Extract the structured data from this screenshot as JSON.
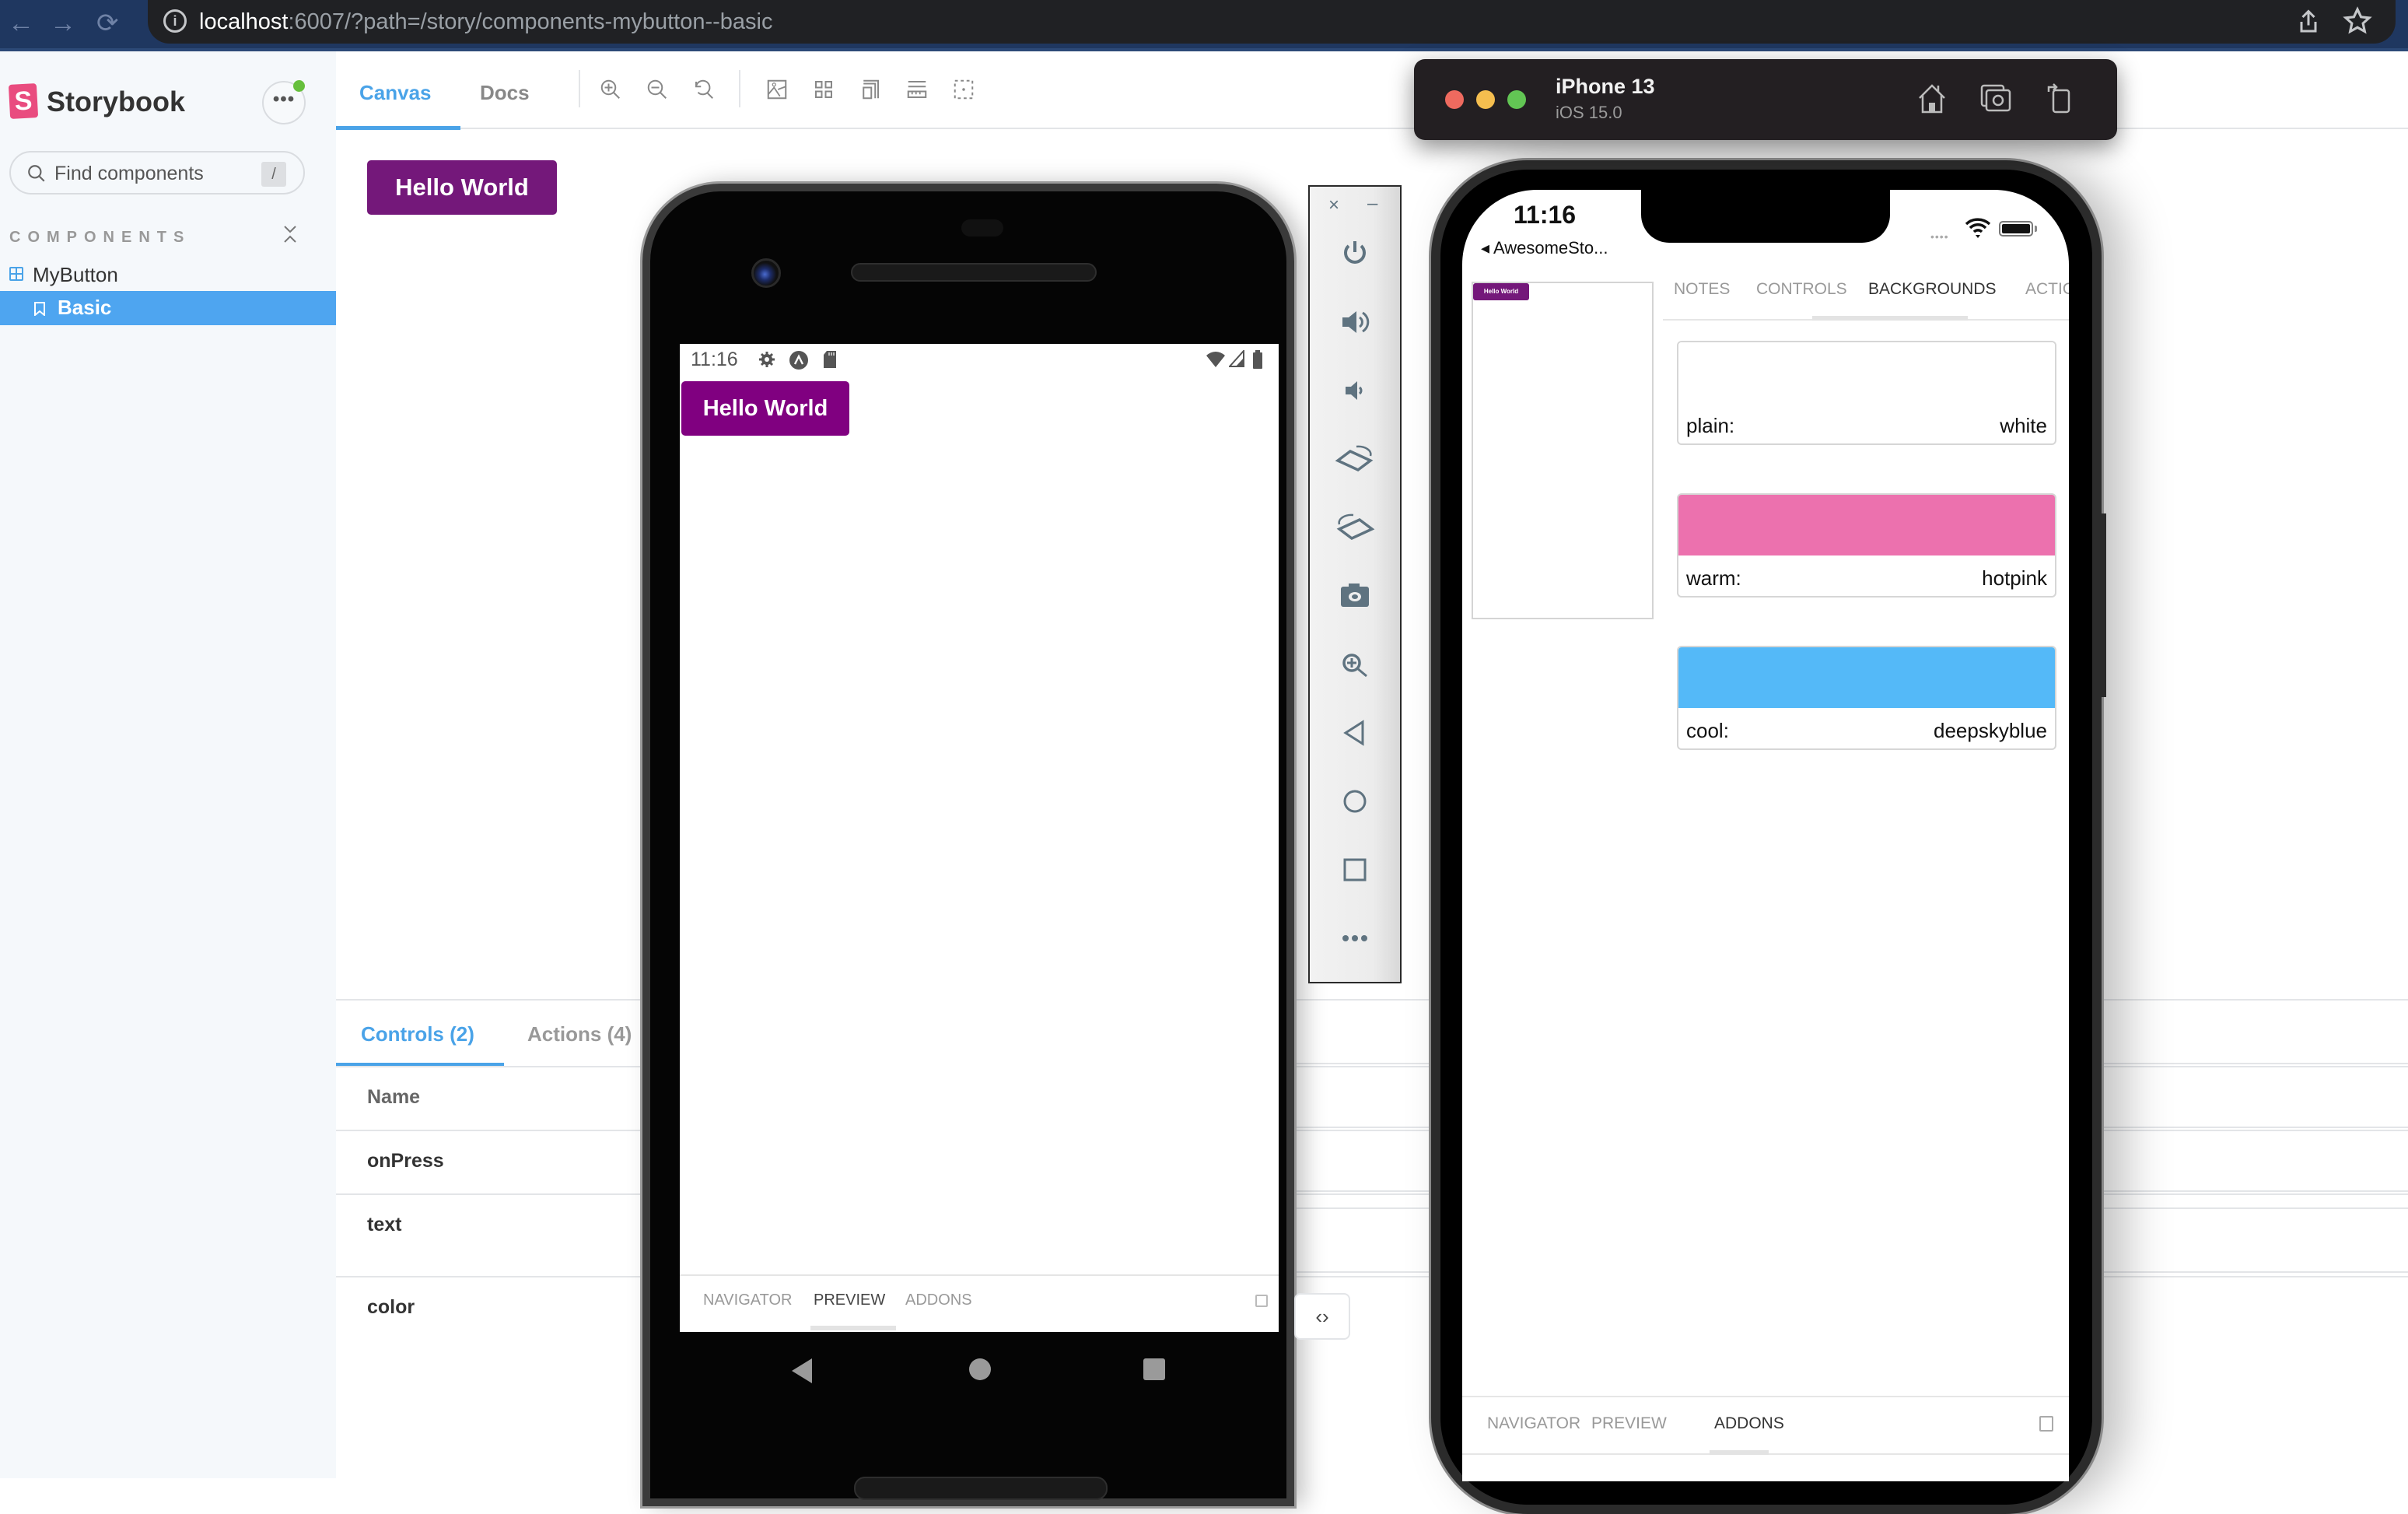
{
  "browser": {
    "url_host": "localhost",
    "url_rest": ":6007/?path=/story/components-mybutton--basic",
    "nav": {
      "back": "←",
      "forward": "→",
      "reload": "⟳"
    }
  },
  "sidebar": {
    "brand": "Storybook",
    "logo_letter": "S",
    "menu_label": "•••",
    "search": {
      "placeholder": "Find components",
      "value": "",
      "shortcut": "/"
    },
    "section_title": "COMPONENTS",
    "tree": [
      {
        "label": "MyButton",
        "type": "component",
        "expanded": true
      },
      {
        "label": "Basic",
        "type": "story",
        "selected": true
      }
    ],
    "selected_color": "#4ea5f0"
  },
  "toolbar": {
    "tabs": [
      {
        "label": "Canvas",
        "active": true
      },
      {
        "label": "Docs",
        "active": false
      }
    ],
    "tools": [
      "zoom-in-icon",
      "zoom-out-icon",
      "zoom-reset-icon",
      "background-icon",
      "grid-icon",
      "viewport-icon",
      "measure-icon",
      "outline-icon"
    ]
  },
  "canvas": {
    "button_label": "Hello World",
    "button_color": "#74187a"
  },
  "addons": {
    "tabs": [
      {
        "label": "Controls (2)",
        "active": true
      },
      {
        "label": "Actions (4)",
        "active": false
      }
    ],
    "header": "Name",
    "rows": [
      {
        "name": "onPress"
      },
      {
        "name": "text"
      },
      {
        "name": "color"
      }
    ]
  },
  "android": {
    "time": "11:16",
    "button_label": "Hello World",
    "button_color": "#800080",
    "bottom_tabs": [
      {
        "label": "NAVIGATOR",
        "active": false
      },
      {
        "label": "PREVIEW",
        "active": true
      },
      {
        "label": "ADDONS",
        "active": false
      }
    ]
  },
  "emulator_panel": {
    "close": "×",
    "minimize": "–",
    "controls": [
      "power-icon",
      "volume-up-icon",
      "volume-down-icon",
      "rotate-left-icon",
      "rotate-right-icon",
      "camera-icon",
      "zoom-icon",
      "back-icon",
      "home-icon",
      "overview-icon",
      "more-icon"
    ]
  },
  "code_toggle": "‹›",
  "ios_simulator": {
    "device_name": "iPhone 13",
    "os_version": "iOS 15.0",
    "time": "11:16",
    "back_label": "◂ AwesomeSto...",
    "signal": "••••",
    "preview_button_label": "Hello World",
    "top_tabs": [
      {
        "label": "NOTES",
        "active": false
      },
      {
        "label": "CONTROLS",
        "active": false
      },
      {
        "label": "BACKGROUNDS",
        "active": true
      },
      {
        "label": "ACTIONS",
        "active": false
      }
    ],
    "backgrounds": [
      {
        "name": "plain:",
        "value": "white",
        "color": "#ffffff"
      },
      {
        "name": "warm:",
        "value": "hotpink",
        "color": "#ec71ae"
      },
      {
        "name": "cool:",
        "value": "deepskyblue",
        "color": "#54b9f8"
      }
    ],
    "bottom_tabs": [
      {
        "label": "NAVIGATOR",
        "active": false
      },
      {
        "label": "PREVIEW",
        "active": false
      },
      {
        "label": "ADDONS",
        "active": true
      }
    ]
  }
}
